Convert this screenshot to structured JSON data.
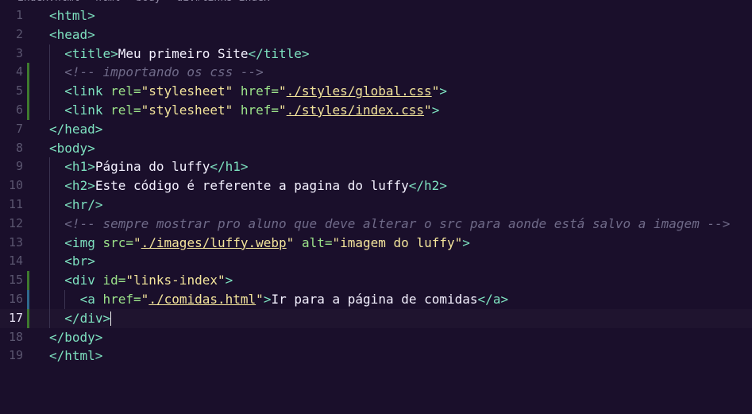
{
  "breadcrumb": {
    "items": [
      "index.html",
      "html",
      "body",
      "div#links-index"
    ]
  },
  "editor": {
    "current_line": 17,
    "lines": [
      {
        "n": "1",
        "tokens": [
          {
            "t": "tag",
            "v": "<html>"
          }
        ],
        "indent": 0
      },
      {
        "n": "2",
        "tokens": [
          {
            "t": "tag",
            "v": "<head>"
          }
        ],
        "indent": 0
      },
      {
        "n": "3",
        "tokens": [
          {
            "t": "tag",
            "v": "<title>"
          },
          {
            "t": "text",
            "v": "Meu primeiro Site"
          },
          {
            "t": "tag",
            "v": "</title>"
          }
        ],
        "indent": 1
      },
      {
        "n": "4",
        "tokens": [
          {
            "t": "comment",
            "v": "<!-- importando os css -->"
          }
        ],
        "indent": 1
      },
      {
        "n": "5",
        "tokens": [
          {
            "t": "tag",
            "v": "<link "
          },
          {
            "t": "attr",
            "v": "rel="
          },
          {
            "t": "str",
            "v": "\"stylesheet\""
          },
          {
            "t": "attr",
            "v": " href="
          },
          {
            "t": "str",
            "v": "\""
          },
          {
            "t": "link",
            "v": "./styles/global.css"
          },
          {
            "t": "str",
            "v": "\""
          },
          {
            "t": "tag",
            "v": ">"
          }
        ],
        "indent": 1
      },
      {
        "n": "6",
        "tokens": [
          {
            "t": "tag",
            "v": "<link "
          },
          {
            "t": "attr",
            "v": "rel="
          },
          {
            "t": "str",
            "v": "\"stylesheet\""
          },
          {
            "t": "attr",
            "v": " href="
          },
          {
            "t": "str",
            "v": "\""
          },
          {
            "t": "link",
            "v": "./styles/index.css"
          },
          {
            "t": "str",
            "v": "\""
          },
          {
            "t": "tag",
            "v": ">"
          }
        ],
        "indent": 1
      },
      {
        "n": "7",
        "tokens": [
          {
            "t": "tag",
            "v": "</head>"
          }
        ],
        "indent": 0
      },
      {
        "n": "8",
        "tokens": [
          {
            "t": "tag",
            "v": "<body>"
          }
        ],
        "indent": 0
      },
      {
        "n": "9",
        "tokens": [
          {
            "t": "tag",
            "v": "<h1>"
          },
          {
            "t": "text",
            "v": "Página do luffy"
          },
          {
            "t": "tag",
            "v": "</h1>"
          }
        ],
        "indent": 1
      },
      {
        "n": "10",
        "tokens": [
          {
            "t": "tag",
            "v": "<h2>"
          },
          {
            "t": "text",
            "v": "Este código é referente a pagina do luffy"
          },
          {
            "t": "tag",
            "v": "</h2>"
          }
        ],
        "indent": 1
      },
      {
        "n": "11",
        "tokens": [
          {
            "t": "tag",
            "v": "<hr/>"
          }
        ],
        "indent": 1
      },
      {
        "n": "12",
        "tokens": [
          {
            "t": "comment",
            "v": "<!-- sempre mostrar pro aluno que deve alterar o src para aonde está salvo a imagem -->"
          }
        ],
        "indent": 1
      },
      {
        "n": "13",
        "tokens": [
          {
            "t": "tag",
            "v": "<img "
          },
          {
            "t": "attr",
            "v": "src="
          },
          {
            "t": "str",
            "v": "\""
          },
          {
            "t": "link",
            "v": "./images/luffy.webp"
          },
          {
            "t": "str",
            "v": "\""
          },
          {
            "t": "attr",
            "v": " alt="
          },
          {
            "t": "str",
            "v": "\"imagem do luffy\""
          },
          {
            "t": "tag",
            "v": ">"
          }
        ],
        "indent": 1
      },
      {
        "n": "14",
        "tokens": [
          {
            "t": "tag",
            "v": "<br>"
          }
        ],
        "indent": 1
      },
      {
        "n": "15",
        "tokens": [
          {
            "t": "tag",
            "v": "<div "
          },
          {
            "t": "attr",
            "v": "id="
          },
          {
            "t": "str",
            "v": "\"links-index\""
          },
          {
            "t": "tag",
            "v": ">"
          }
        ],
        "indent": 1
      },
      {
        "n": "16",
        "tokens": [
          {
            "t": "tag",
            "v": "<a "
          },
          {
            "t": "attr",
            "v": "href="
          },
          {
            "t": "str",
            "v": "\""
          },
          {
            "t": "link",
            "v": "./comidas.html"
          },
          {
            "t": "str",
            "v": "\""
          },
          {
            "t": "tag",
            "v": ">"
          },
          {
            "t": "text",
            "v": "Ir para a página de comidas"
          },
          {
            "t": "tag",
            "v": "</a>"
          }
        ],
        "indent": 2
      },
      {
        "n": "17",
        "tokens": [
          {
            "t": "tag",
            "v": "</div>"
          }
        ],
        "indent": 1
      },
      {
        "n": "18",
        "tokens": [
          {
            "t": "tag",
            "v": "</body>"
          }
        ],
        "indent": 0
      },
      {
        "n": "19",
        "tokens": [
          {
            "t": "tag",
            "v": "</html>"
          }
        ],
        "indent": 0
      }
    ],
    "git_markers": {
      "4": "added",
      "5": "added",
      "6": "added",
      "15": "added",
      "16": "modified",
      "17": "added"
    }
  },
  "colors": {
    "background": "#1a0f2b",
    "tag": "#7ee2c0",
    "attribute": "#9ce38a",
    "string": "#f3e49b",
    "comment": "#6f6a88",
    "text": "#f4f1ff"
  }
}
